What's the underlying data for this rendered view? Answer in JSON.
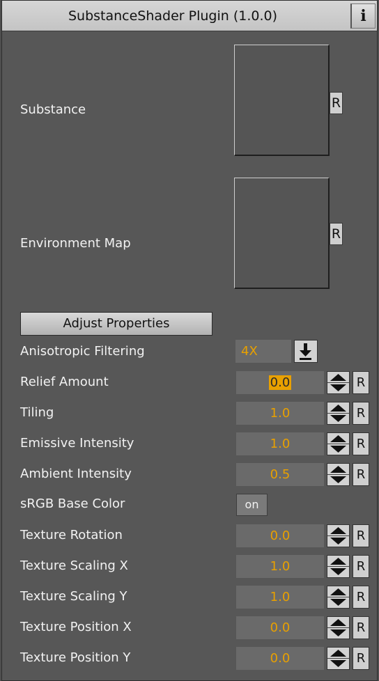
{
  "window": {
    "title": "SubstanceShader Plugin (1.0.0)",
    "info_label": "i"
  },
  "substance": {
    "label": "Substance",
    "reset_label": "R"
  },
  "environment_map": {
    "label": "Environment Map",
    "reset_label": "R"
  },
  "adjust_button": "Adjust Properties",
  "anisotropic": {
    "label": "Anisotropic Filtering",
    "value": "4X"
  },
  "rows": [
    {
      "label": "Relief Amount",
      "value": "0.0",
      "reset": "R"
    },
    {
      "label": "Tiling",
      "value": "1.0",
      "reset": "R"
    },
    {
      "label": "Emissive Intensity",
      "value": "1.0",
      "reset": "R"
    },
    {
      "label": "Ambient Intensity",
      "value": "0.5",
      "reset": "R"
    }
  ],
  "srgb": {
    "label": "sRGB Base Color",
    "value": "on"
  },
  "rows2": [
    {
      "label": "Texture Rotation",
      "value": "0.0",
      "reset": "R"
    },
    {
      "label": "Texture Scaling X",
      "value": "1.0",
      "reset": "R"
    },
    {
      "label": "Texture Scaling Y",
      "value": "1.0",
      "reset": "R"
    },
    {
      "label": "Texture Position X",
      "value": "0.0",
      "reset": "R"
    },
    {
      "label": "Texture Position Y",
      "value": "0.0",
      "reset": "R"
    }
  ],
  "colors": {
    "value_text": "#e8a000",
    "panel_bg": "#575757",
    "field_bg": "#6a6a6a"
  },
  "icons": {
    "info": "info-icon",
    "dropdown": "dropdown-arrow-icon",
    "spinner_up": "spin-up-icon",
    "spinner_down": "spin-down-icon"
  }
}
